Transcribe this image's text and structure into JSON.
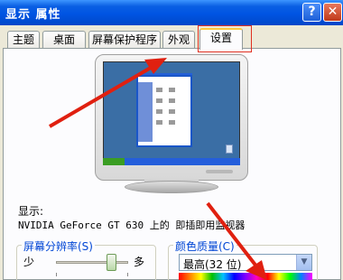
{
  "window": {
    "title": "显示 属性",
    "help_label": "?",
    "close_label": "✕"
  },
  "tabs": [
    {
      "label": "主题",
      "active": false
    },
    {
      "label": "桌面",
      "active": false
    },
    {
      "label": "屏幕保护程序",
      "active": false
    },
    {
      "label": "外观",
      "active": false
    },
    {
      "label": "设置",
      "active": true
    }
  ],
  "display": {
    "label": "显示:",
    "device": "NVIDIA GeForce GT 630 上的 即插即用监视器"
  },
  "resolution": {
    "title": "屏幕分辨率(S)",
    "less_label": "少",
    "more_label": "多"
  },
  "color_quality": {
    "title": "颜色质量(C)",
    "value": "最高(32 位)"
  },
  "icons": {
    "help": "help-icon",
    "close": "close-icon",
    "dropdown": "chevron-down-icon"
  },
  "colors": {
    "titlebar": "#0054e3",
    "annotation_arrow": "#e02010",
    "group_title": "#0046d5"
  }
}
